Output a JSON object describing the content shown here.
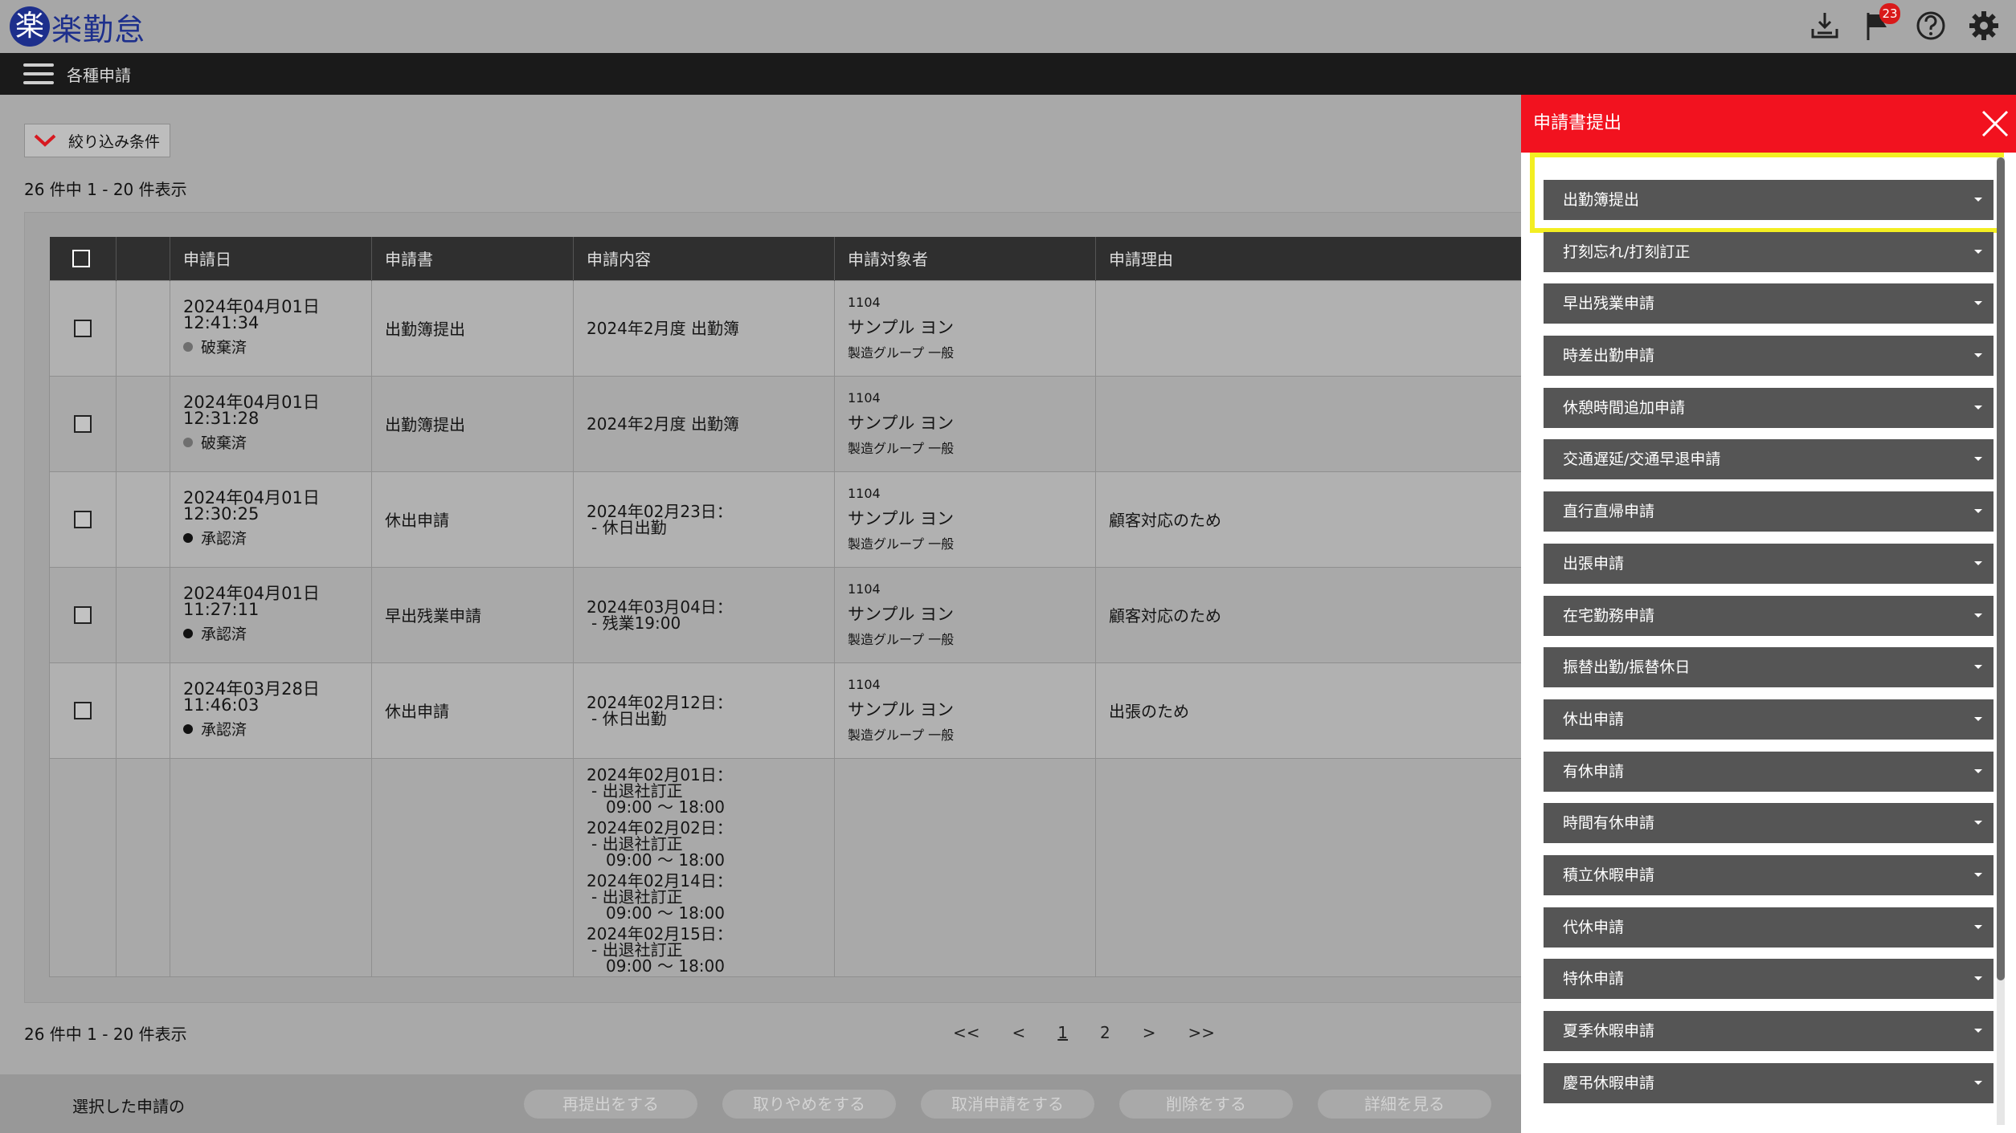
{
  "app": {
    "logo_mark": "楽",
    "name": "楽勤怠",
    "notification_count": "23"
  },
  "nav": {
    "title": "各種申請"
  },
  "filter": {
    "label": "絞り込み条件"
  },
  "count_text": "26 件中 1 - 20 件表示",
  "table": {
    "headers": [
      "申請日",
      "申請書",
      "申請内容",
      "申請対象者",
      "申請理由"
    ],
    "rows": [
      {
        "date": "2024年04月01日",
        "time": "12:41:34",
        "status": "破棄済",
        "status_color": "#6f6f6f",
        "form": "出勤簿提出",
        "content1": "2024年2月度 出勤簿",
        "content2": "",
        "emp_id": "1104",
        "emp_name": "サンプル ヨン",
        "emp_group": "製造グループ 一般",
        "reason": ""
      },
      {
        "date": "2024年04月01日",
        "time": "12:31:28",
        "status": "破棄済",
        "status_color": "#6f6f6f",
        "form": "出勤簿提出",
        "content1": "2024年2月度 出勤簿",
        "content2": "",
        "emp_id": "1104",
        "emp_name": "サンプル ヨン",
        "emp_group": "製造グループ 一般",
        "reason": ""
      },
      {
        "date": "2024年04月01日",
        "time": "12:30:25",
        "status": "承認済",
        "status_color": "#111111",
        "form": "休出申請",
        "content1": "2024年02月23日：",
        "content2": "- 休日出勤",
        "emp_id": "1104",
        "emp_name": "サンプル ヨン",
        "emp_group": "製造グループ 一般",
        "reason": "顧客対応のため"
      },
      {
        "date": "2024年04月01日",
        "time": "11:27:11",
        "status": "承認済",
        "status_color": "#111111",
        "form": "早出残業申請",
        "content1": "2024年03月04日：",
        "content2": "- 残業19:00",
        "emp_id": "1104",
        "emp_name": "サンプル ヨン",
        "emp_group": "製造グループ 一般",
        "reason": "顧客対応のため"
      },
      {
        "date": "2024年03月28日",
        "time": "11:46:03",
        "status": "承認済",
        "status_color": "#111111",
        "form": "休出申請",
        "content1": "2024年02月12日：",
        "content2": "- 休日出勤",
        "emp_id": "1104",
        "emp_name": "サンプル ヨン",
        "emp_group": "製造グループ 一般",
        "reason": "出張のため"
      }
    ],
    "corrections": [
      {
        "date": "2024年02月01日：",
        "kind": "- 出退社訂正",
        "time": "09:00 ～ 18:00"
      },
      {
        "date": "2024年02月02日：",
        "kind": "- 出退社訂正",
        "time": "09:00 ～ 18:00"
      },
      {
        "date": "2024年02月14日：",
        "kind": "- 出退社訂正",
        "time": "09:00 ～ 18:00"
      },
      {
        "date": "2024年02月15日：",
        "kind": "- 出退社訂正",
        "time": "09:00 ～ 18:00"
      }
    ]
  },
  "pager": {
    "first": "<<",
    "prev": "<",
    "page1": "1",
    "page2": "2",
    "next": ">",
    "last": ">>"
  },
  "actions": {
    "label": "選択した申請の",
    "buttons": [
      "再提出をする",
      "取りやめをする",
      "取消申請をする",
      "削除をする",
      "詳細を見る"
    ]
  },
  "panel": {
    "title": "申請書提出",
    "items": [
      "出勤簿提出",
      "打刻忘れ/打刻訂正",
      "早出残業申請",
      "時差出勤申請",
      "休憩時間追加申請",
      "交通遅延/交通早退申請",
      "直行直帰申請",
      "出張申請",
      "在宅勤務申請",
      "振替出勤/振替休日",
      "休出申請",
      "有休申請",
      "時間有休申請",
      "積立休暇申請",
      "代休申請",
      "特休申請",
      "夏季休暇申請",
      "慶弔休暇申請"
    ]
  }
}
